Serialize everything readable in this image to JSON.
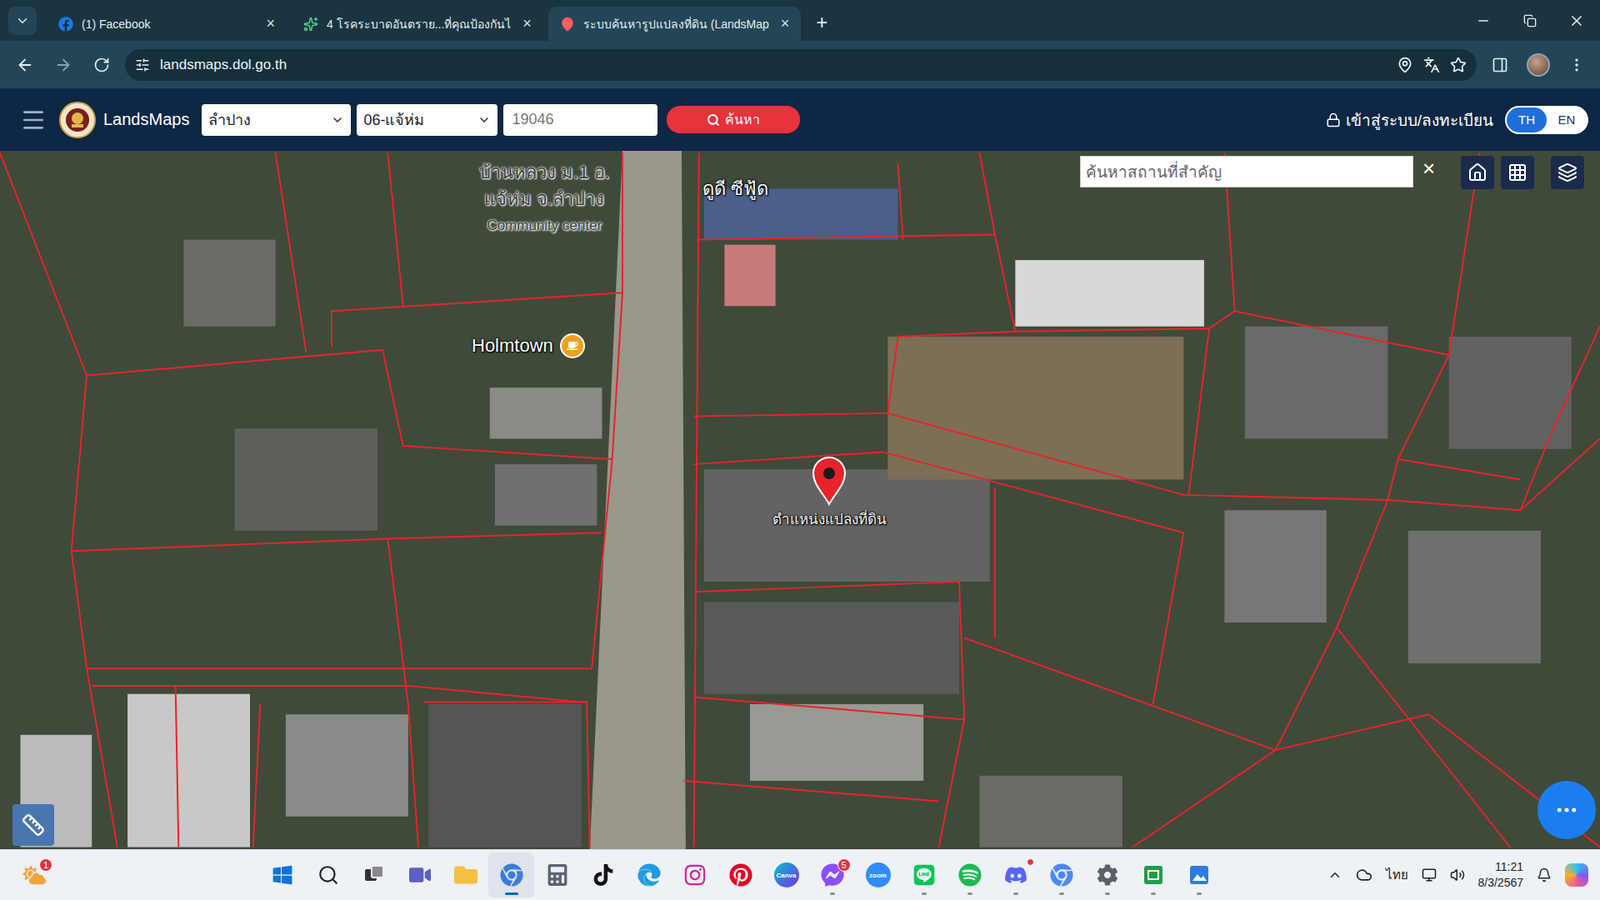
{
  "browser": {
    "tabs": [
      {
        "label": "(1) Facebook",
        "close": "×",
        "selected": false,
        "kind": "facebook"
      },
      {
        "label": "4 โรคระบาดอันตราย...ที่คุณป้องกันไ",
        "close": "×",
        "selected": false,
        "kind": "article"
      },
      {
        "label": "ระบบค้นหารูปแปลงที่ดิน (LandsMap",
        "close": "×",
        "selected": true,
        "kind": "landsmaps"
      }
    ],
    "new_tab": "+",
    "url": "landsmaps.dol.go.th"
  },
  "header": {
    "brand": "LandsMaps",
    "province": "ลำปาง",
    "district": "06-แจ้ห่ม",
    "parcel": {
      "placeholder": "19046"
    },
    "search_button": "ค้นหา",
    "login": "เข้าสู่ระบบ/ลงทะเบียน",
    "languages": [
      {
        "label": "TH",
        "selected": true
      },
      {
        "label": "EN",
        "selected": false
      }
    ]
  },
  "map": {
    "place_search": {
      "placeholder": "ค้นหาสถานที่สำคัญ",
      "clear": "×"
    },
    "labels": [
      {
        "kind": "community",
        "lines": [
          "บ้านหลวง ม.1 อ.",
          "แจ้ห่ม จ.ลำปาง",
          "Community center"
        ],
        "color": "#3a3a3a"
      },
      {
        "kind": "restaurant",
        "lines": [
          "ดูดี ซีฟู้ด"
        ],
        "color": "#ffffff"
      },
      {
        "kind": "cafe",
        "lines": [
          "Holmtown"
        ],
        "color": "#ffffff"
      }
    ],
    "pin": {
      "label": "ตำแหน่งแปลงที่ดิน"
    }
  },
  "taskbar": {
    "widget": {
      "badge": "1"
    },
    "apps": [
      {
        "kind": "start",
        "running": false,
        "selected": false
      },
      {
        "kind": "search",
        "running": false,
        "selected": false
      },
      {
        "kind": "taskview",
        "running": false,
        "selected": false
      },
      {
        "kind": "meet",
        "running": false,
        "selected": false
      },
      {
        "kind": "files",
        "running": false,
        "selected": false
      },
      {
        "kind": "chrome",
        "running": true,
        "selected": true
      },
      {
        "kind": "calculator",
        "running": false,
        "selected": false
      },
      {
        "kind": "tiktok",
        "running": false,
        "selected": false
      },
      {
        "kind": "edge",
        "running": false,
        "selected": false
      },
      {
        "kind": "instagram",
        "running": false,
        "selected": false
      },
      {
        "kind": "pinterest",
        "running": false,
        "selected": false
      },
      {
        "kind": "canva",
        "text": "Canva",
        "running": false,
        "selected": false
      },
      {
        "kind": "messenger",
        "badge": "5",
        "running": true,
        "selected": false
      },
      {
        "kind": "zoom",
        "text": "zoom",
        "running": false,
        "selected": false
      },
      {
        "kind": "line",
        "running": true,
        "selected": false
      },
      {
        "kind": "spotify",
        "running": true,
        "selected": false
      },
      {
        "kind": "discord",
        "badge": "",
        "running": true,
        "selected": false
      },
      {
        "kind": "chrome-profile",
        "running": true,
        "selected": false
      },
      {
        "kind": "settings",
        "running": true,
        "selected": false
      },
      {
        "kind": "sheets",
        "running": true,
        "selected": false
      },
      {
        "kind": "photos",
        "running": true,
        "selected": false
      }
    ],
    "tray": {
      "language": "ไทย",
      "time": "11:21",
      "date": "8/3/2567"
    }
  }
}
